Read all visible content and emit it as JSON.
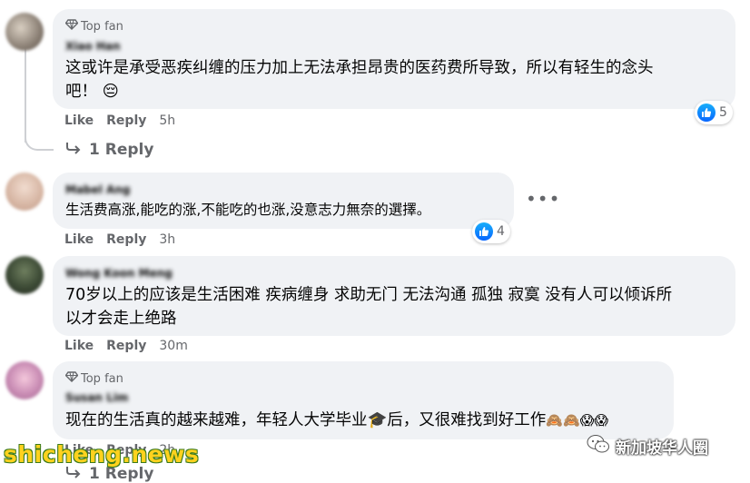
{
  "comments": [
    {
      "badge": "Top fan",
      "author": "Xiao Han",
      "text_line1": "这或许是承受恶疾纠缠的压力加上无法承担昂贵的医药费所导致，所以有轻生的念头",
      "text_line2": "吧！",
      "emoji": "😔",
      "like": "Like",
      "reply": "Reply",
      "time": "5h",
      "reactions": "5",
      "replies_link": "1 Reply"
    },
    {
      "author": "Mabel Ang",
      "text": "生活费高涨,能吃的涨,不能吃的也涨,没意志力無奈的選擇。",
      "like": "Like",
      "reply": "Reply",
      "time": "3h",
      "reactions": "4"
    },
    {
      "author": "Wong Koon Meng",
      "text_line1": "70岁以上的应该是生活困难 疾病缠身 求助无门 无法沟通 孤独 寂寞 没有人可以倾诉所",
      "text_line2": "以才会走上绝路",
      "like": "Like",
      "reply": "Reply",
      "time": "30m"
    },
    {
      "badge": "Top fan",
      "author": "Susan Lim",
      "text_a": "现在的生活真的越来越难，年轻人大学毕业",
      "text_b": "后，又很难找到好工作",
      "emoji_mid": "🎓",
      "emoji_end": "🙈🙈😱😱",
      "like": "Like",
      "reply": "Reply",
      "time": "2h",
      "replies_link": "1 Reply"
    }
  ],
  "watermark_left": "shicheng.news",
  "watermark_right": "新加坡华人圈",
  "colors": {
    "bubble": "#f0f2f5",
    "muted": "#65676b",
    "like_blue": "#0866ff"
  }
}
